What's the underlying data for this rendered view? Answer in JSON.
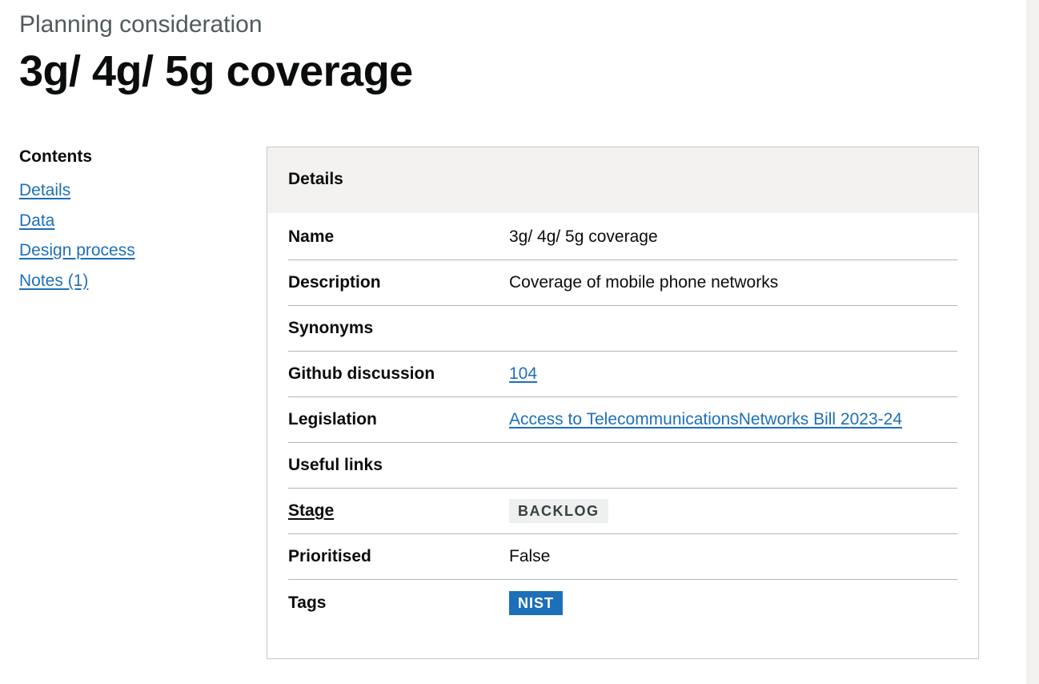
{
  "header": {
    "caption": "Planning consideration",
    "title": "3g/ 4g/ 5g coverage"
  },
  "contents": {
    "heading": "Contents",
    "items": [
      {
        "label": "Details"
      },
      {
        "label": "Data"
      },
      {
        "label": "Design process"
      },
      {
        "label": "Notes (1)"
      }
    ]
  },
  "details": {
    "heading": "Details",
    "rows": [
      {
        "key": "Name",
        "value": "3g/ 4g/ 5g coverage"
      },
      {
        "key": "Description",
        "value": "Coverage of mobile phone networks"
      },
      {
        "key": "Synonyms",
        "value": ""
      },
      {
        "key": "Github discussion",
        "value": "104"
      },
      {
        "key": "Legislation",
        "value": "Access to TelecommunicationsNetworks Bill 2023-24"
      },
      {
        "key": "Useful links",
        "value": ""
      },
      {
        "key": "Stage",
        "value": "BACKLOG"
      },
      {
        "key": "Prioritised",
        "value": "False"
      },
      {
        "key": "Tags",
        "value": "NIST"
      }
    ]
  },
  "colors": {
    "link": "#1d70b8",
    "tag_blue": "#1d70b8",
    "tag_grey_bg": "#eeefef",
    "header_bg": "#f3f2f1"
  }
}
